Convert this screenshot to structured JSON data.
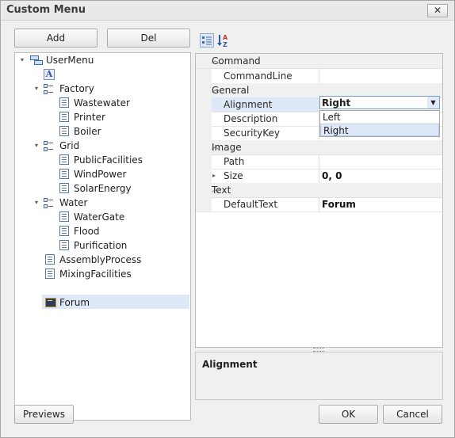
{
  "window": {
    "title": "Custom Menu"
  },
  "toolbar": {
    "add_label": "Add",
    "del_label": "Del"
  },
  "tree": {
    "root": "UserMenu",
    "items": [
      "Factory",
      "Wastewater",
      "Printer",
      "Boiler",
      "Grid",
      "PublicFacilities",
      "WindPower",
      "SolarEnergy",
      "Water",
      "WaterGate",
      "Flood",
      "Purification",
      "AssemblyProcess",
      "MixingFacilities",
      "Forum"
    ]
  },
  "grid": {
    "categories": [
      "Command",
      "General",
      "Image",
      "Text"
    ],
    "properties": [
      {
        "name": "CommandLine",
        "value": ""
      },
      {
        "name": "Alignment",
        "value": "Right"
      },
      {
        "name": "Description",
        "value": ""
      },
      {
        "name": "SecurityKey",
        "value": ""
      },
      {
        "name": "Path",
        "value": ""
      },
      {
        "name": "Size",
        "value": "0, 0"
      },
      {
        "name": "DefaultText",
        "value": "Forum"
      }
    ],
    "dropdown_options": [
      "Left",
      "Right"
    ]
  },
  "description": {
    "title": "Alignment"
  },
  "footer": {
    "previews_label": "Previews",
    "ok_label": "OK",
    "cancel_label": "Cancel"
  },
  "colors": {
    "selection": "#dfe8f6",
    "accent": "#4a6b95"
  }
}
